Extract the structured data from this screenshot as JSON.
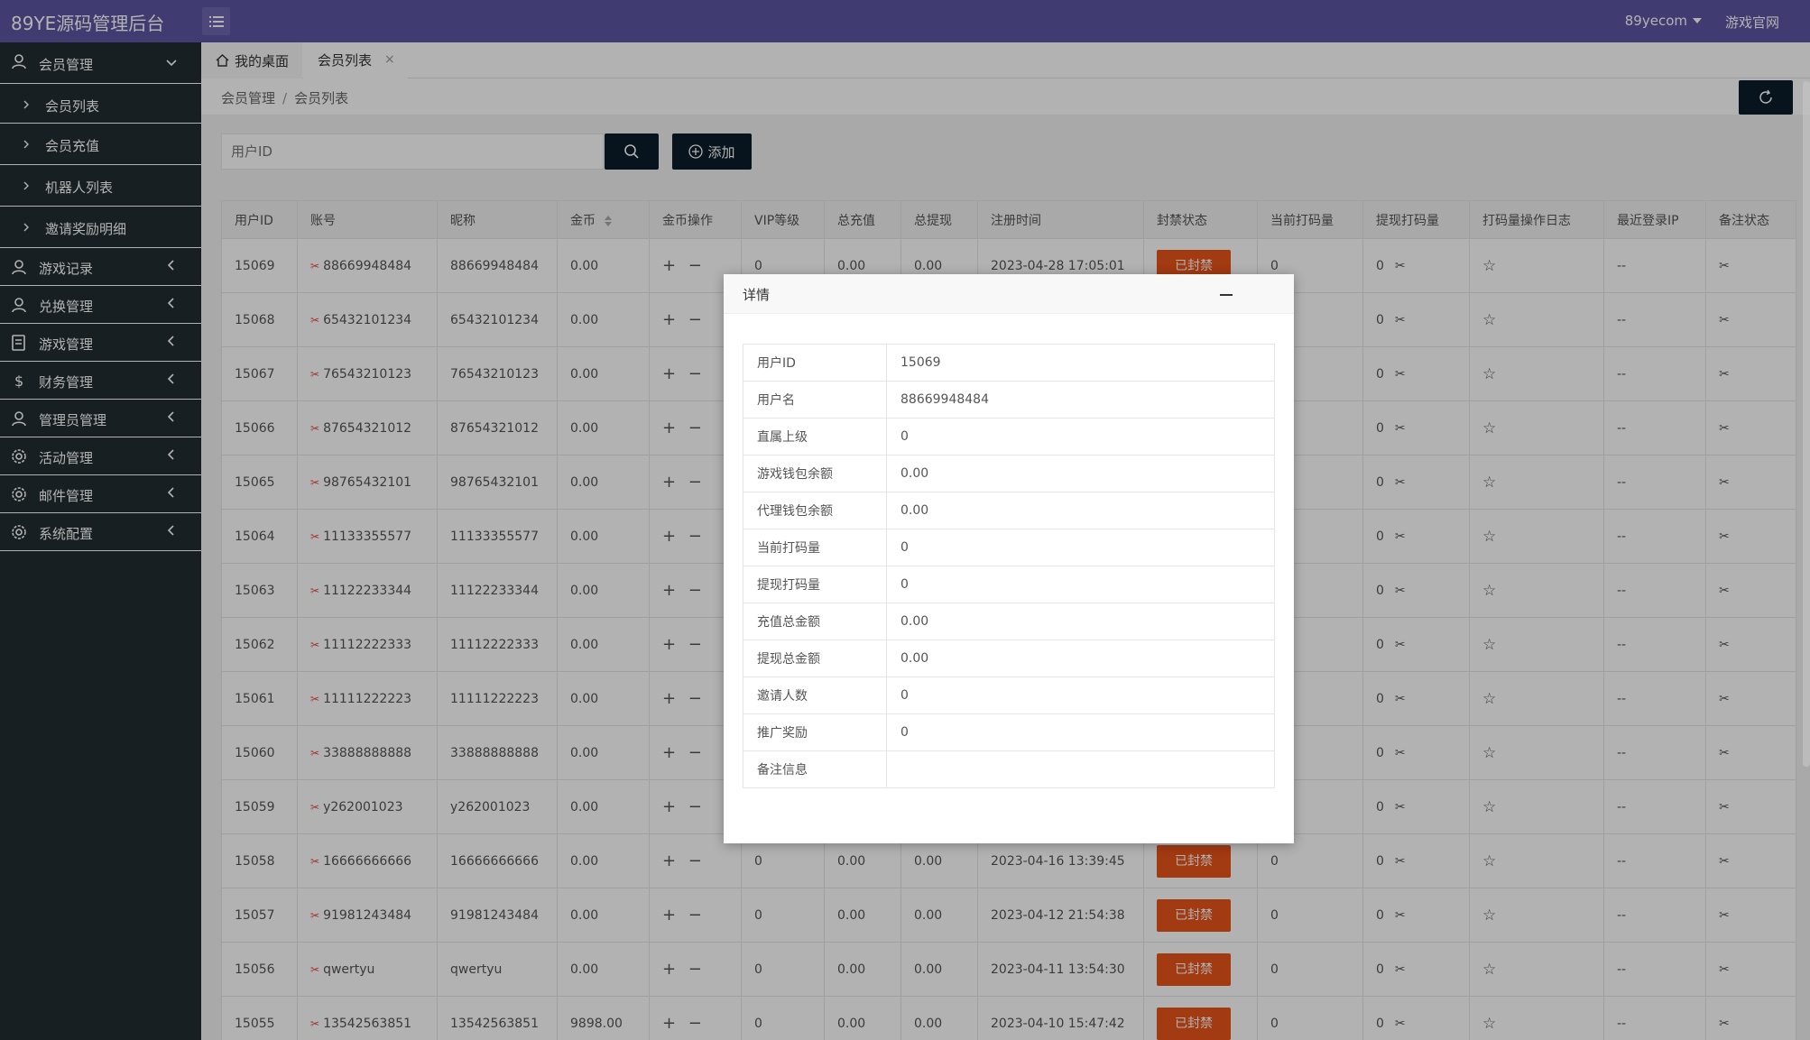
{
  "app": {
    "title": "89YE源码管理后台"
  },
  "topbar": {
    "user": "89yecom",
    "site_link": "游戏官网"
  },
  "sidebar": {
    "member": {
      "label": "会员管理",
      "children": [
        "会员列表",
        "会员充值",
        "机器人列表",
        "邀请奖励明细"
      ]
    },
    "items": [
      "游戏记录",
      "兑换管理",
      "游戏管理",
      "财务管理",
      "管理员管理",
      "活动管理",
      "邮件管理",
      "系统配置"
    ]
  },
  "tabs": {
    "home": "我的桌面",
    "active": "会员列表",
    "close": "×"
  },
  "breadcrumb": {
    "parent": "会员管理",
    "sep": "/",
    "current": "会员列表"
  },
  "search": {
    "placeholder": "用户ID",
    "add_label": "添加"
  },
  "table": {
    "headers": [
      "用户ID",
      "账号",
      "昵称",
      "金币",
      "金币操作",
      "VIP等级",
      "总充值",
      "总提现",
      "注册时间",
      "封禁状态",
      "当前打码量",
      "提现打码量",
      "打码量操作日志",
      "最近登录IP",
      "备注状态"
    ],
    "ban_label": "已封禁",
    "pm": "+ −",
    "ip_empty": "--",
    "rows": [
      {
        "id": "15069",
        "account": "88669948484",
        "nick": "88669948484",
        "gold": "0.00",
        "vip": "0",
        "recharge": "0.00",
        "withdraw": "0.00",
        "reg": "2023-04-28 17:05:01",
        "bet": "0",
        "wbet": "0"
      },
      {
        "id": "15068",
        "account": "65432101234",
        "nick": "65432101234",
        "gold": "0.00",
        "vip": "",
        "recharge": "",
        "withdraw": "",
        "reg": "",
        "bet": "",
        "wbet": "0"
      },
      {
        "id": "15067",
        "account": "76543210123",
        "nick": "76543210123",
        "gold": "0.00",
        "vip": "",
        "recharge": "",
        "withdraw": "",
        "reg": "",
        "bet": "",
        "wbet": "0"
      },
      {
        "id": "15066",
        "account": "87654321012",
        "nick": "87654321012",
        "gold": "0.00",
        "vip": "",
        "recharge": "",
        "withdraw": "",
        "reg": "",
        "bet": "",
        "wbet": "0"
      },
      {
        "id": "15065",
        "account": "98765432101",
        "nick": "98765432101",
        "gold": "0.00",
        "vip": "",
        "recharge": "",
        "withdraw": "",
        "reg": "",
        "bet": "",
        "wbet": "0"
      },
      {
        "id": "15064",
        "account": "11133355577",
        "nick": "11133355577",
        "gold": "0.00",
        "vip": "",
        "recharge": "",
        "withdraw": "",
        "reg": "",
        "bet": "",
        "wbet": "0"
      },
      {
        "id": "15063",
        "account": "11122233344",
        "nick": "11122233344",
        "gold": "0.00",
        "vip": "",
        "recharge": "",
        "withdraw": "",
        "reg": "",
        "bet": "",
        "wbet": "0"
      },
      {
        "id": "15062",
        "account": "11112222333",
        "nick": "11112222333",
        "gold": "0.00",
        "vip": "",
        "recharge": "",
        "withdraw": "",
        "reg": "",
        "bet": "",
        "wbet": "0"
      },
      {
        "id": "15061",
        "account": "11111222223",
        "nick": "11111222223",
        "gold": "0.00",
        "vip": "",
        "recharge": "",
        "withdraw": "",
        "reg": "",
        "bet": "",
        "wbet": "0"
      },
      {
        "id": "15060",
        "account": "33888888888",
        "nick": "33888888888",
        "gold": "0.00",
        "vip": "",
        "recharge": "",
        "withdraw": "",
        "reg": "",
        "bet": "",
        "wbet": "0"
      },
      {
        "id": "15059",
        "account": "y262001023",
        "nick": "y262001023",
        "gold": "0.00",
        "vip": "",
        "recharge": "",
        "withdraw": "",
        "reg": "",
        "bet": "",
        "wbet": "0"
      },
      {
        "id": "15058",
        "account": "16666666666",
        "nick": "16666666666",
        "gold": "0.00",
        "vip": "0",
        "recharge": "0.00",
        "withdraw": "0.00",
        "reg": "2023-04-16 13:39:45",
        "bet": "0",
        "wbet": "0"
      },
      {
        "id": "15057",
        "account": "91981243484",
        "nick": "91981243484",
        "gold": "0.00",
        "vip": "0",
        "recharge": "0.00",
        "withdraw": "0.00",
        "reg": "2023-04-12 21:54:38",
        "bet": "0",
        "wbet": "0"
      },
      {
        "id": "15056",
        "account": "qwertyu",
        "nick": "qwertyu",
        "gold": "0.00",
        "vip": "0",
        "recharge": "0.00",
        "withdraw": "0.00",
        "reg": "2023-04-11 13:54:30",
        "bet": "0",
        "wbet": "0"
      },
      {
        "id": "15055",
        "account": "13542563851",
        "nick": "13542563851",
        "gold": "9898.00",
        "vip": "0",
        "recharge": "0.00",
        "withdraw": "0.00",
        "reg": "2023-04-10 15:47:42",
        "bet": "0",
        "wbet": "0"
      }
    ]
  },
  "modal": {
    "title": "详情",
    "rows": [
      {
        "k": "用户ID",
        "v": "15069"
      },
      {
        "k": "用户名",
        "v": "88669948484"
      },
      {
        "k": "直属上级",
        "v": "0"
      },
      {
        "k": "游戏钱包余额",
        "v": "0.00"
      },
      {
        "k": "代理钱包余额",
        "v": "0.00"
      },
      {
        "k": "当前打码量",
        "v": "0"
      },
      {
        "k": "提现打码量",
        "v": "0"
      },
      {
        "k": "充值总金额",
        "v": "0.00"
      },
      {
        "k": "提现总金额",
        "v": "0.00"
      },
      {
        "k": "邀请人数",
        "v": "0"
      },
      {
        "k": "推广奖励",
        "v": "0"
      },
      {
        "k": "备注信息",
        "v": ""
      }
    ]
  },
  "colors": {
    "topbar": "#5c55a3",
    "sidebar": "#222d32",
    "ban": "#e9531b",
    "dark_btn": "#0c1e2a"
  }
}
